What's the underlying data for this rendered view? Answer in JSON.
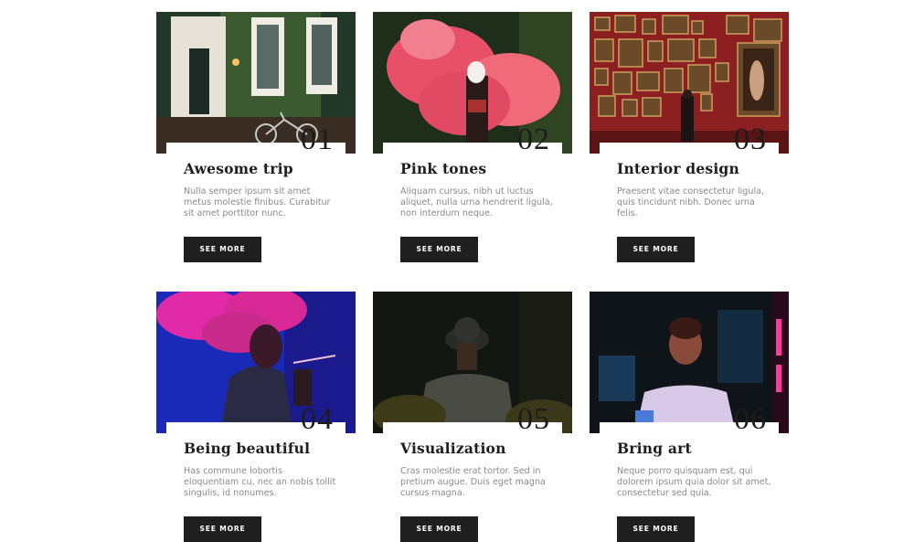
{
  "cards": [
    {
      "number": "01",
      "title": "Awesome trip",
      "description": "Nulla semper ipsum sit amet metus molestie finibus. Curabitur sit amet porttitor nunc.",
      "button": "SEE MORE"
    },
    {
      "number": "02",
      "title": "Pink tones",
      "description": "Aliquam cursus, nibh ut luctus aliquet, nulla urna hendrerit ligula, non interdum neque.",
      "button": "SEE MORE"
    },
    {
      "number": "03",
      "title": "Interior design",
      "description": "Praesent vitae consectetur ligula, quis tincidunt nibh. Donec urna felis.",
      "button": "SEE MORE"
    },
    {
      "number": "04",
      "title": "Being beautiful",
      "description": "Has commune lobortis eloquentiam cu, nec an nobis tollit singulis, id nonumes.",
      "button": "SEE MORE"
    },
    {
      "number": "05",
      "title": "Visualization",
      "description": "Cras molestie erat tortor. Sed in pretium augue. Duis eget magna cursus magna.",
      "button": "SEE MORE"
    },
    {
      "number": "06",
      "title": "Bring art",
      "description": "Neque porro quisquam est, qui dolorem ipsum quia dolor sit amet, consectetur sed quia.",
      "button": "SEE MORE"
    }
  ]
}
